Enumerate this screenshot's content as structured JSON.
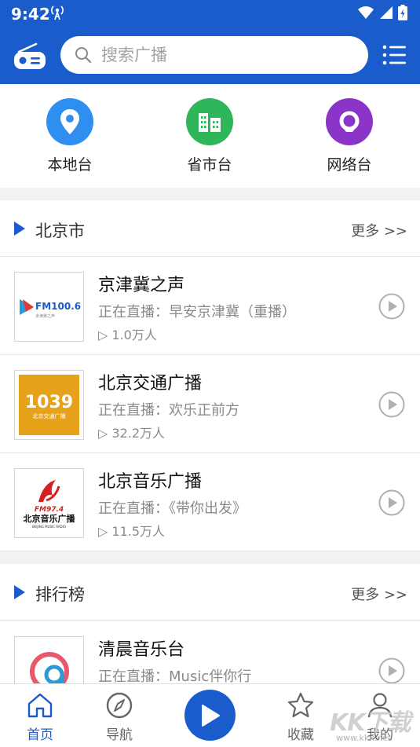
{
  "status_bar": {
    "time": "9:42"
  },
  "header": {
    "search_placeholder": "搜索广播"
  },
  "categories": [
    {
      "label": "本地台",
      "icon": "location-pin-icon",
      "color": "#2f8ff0"
    },
    {
      "label": "省市台",
      "icon": "building-icon",
      "color": "#2fb55a"
    },
    {
      "label": "网络台",
      "icon": "network-q-icon",
      "color": "#8a35c8"
    }
  ],
  "sections": [
    {
      "title": "北京市",
      "more": "更多 >>",
      "stations": [
        {
          "name": "京津冀之声",
          "now": "正在直播：早安京津冀（重播）",
          "listeners": "1.0万人",
          "logo_text": "FM100.6",
          "logo_sub": "京津冀之声"
        },
        {
          "name": "北京交通广播",
          "now": "正在直播：欢乐正前方",
          "listeners": "32.2万人",
          "logo_text": "1039",
          "logo_sub": "北京交通广播"
        },
        {
          "name": "北京音乐广播",
          "now": "正在直播：《带你出发》",
          "listeners": "11.5万人",
          "logo_text": "FM97.4",
          "logo_sub": "北京音乐广播",
          "logo_en": "BEIJING MUSIC RADIO"
        }
      ]
    },
    {
      "title": "排行榜",
      "more": "更多 >>",
      "stations": [
        {
          "name": "清晨音乐台",
          "now": "正在直播：Music伴你行",
          "listeners": ""
        }
      ]
    }
  ],
  "bottom_nav": [
    {
      "label": "首页",
      "icon": "home-icon",
      "active": true
    },
    {
      "label": "导航",
      "icon": "compass-icon",
      "active": false
    },
    {
      "label": "收藏",
      "icon": "star-icon",
      "active": false
    },
    {
      "label": "我的",
      "icon": "user-icon",
      "active": false
    }
  ],
  "watermark": {
    "main": "KK下载",
    "url": "www.kkx.net"
  },
  "colors": {
    "primary": "#1a5ccc"
  }
}
